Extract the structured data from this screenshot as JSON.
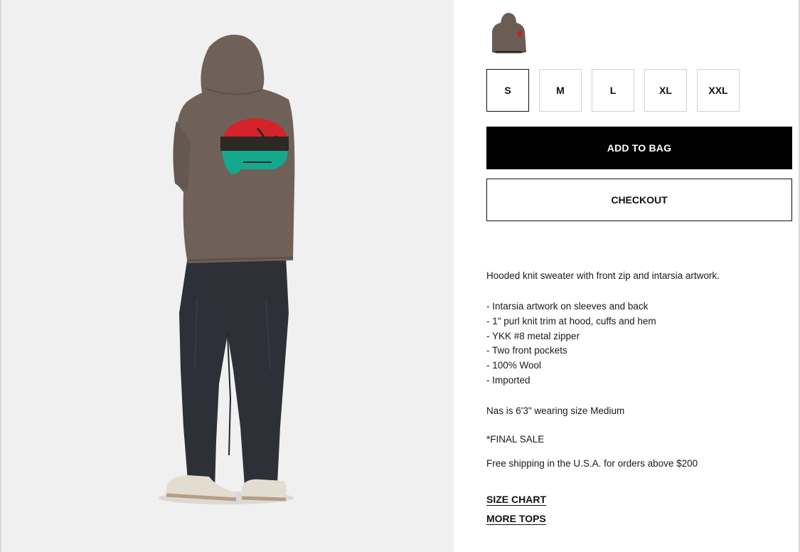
{
  "product": {
    "image_alt": "model wearing brown hooded knit sweater with intarsia artwork on back",
    "thumbnail_alt": "hooded knit sweater thumbnail"
  },
  "sizes": [
    {
      "label": "S",
      "selected": true
    },
    {
      "label": "M",
      "selected": false
    },
    {
      "label": "L",
      "selected": false
    },
    {
      "label": "XL",
      "selected": false
    },
    {
      "label": "XXL",
      "selected": false
    }
  ],
  "actions": {
    "add_to_bag": "ADD TO BAG",
    "checkout": "CHECKOUT"
  },
  "description": {
    "intro": "Hooded knit sweater with front zip and intarsia artwork.",
    "features": [
      "- Intarsia artwork on sleeves and back",
      "- 1\" purl knit trim at hood, cuffs and hem",
      "- YKK #8 metal zipper",
      "- Two front pockets",
      "- 100% Wool",
      "- Imported"
    ],
    "fit_note": "Nas is 6'3\" wearing size Medium",
    "final_sale": "*FINAL SALE",
    "shipping": "Free shipping in the U.S.A. for orders above $200"
  },
  "links": {
    "size_chart": "SIZE CHART",
    "more_tops": "MORE TOPS"
  },
  "colors": {
    "sweater": "#6f6158",
    "pants": "#2e3038",
    "art_red": "#d4232b",
    "art_teal": "#14a88f",
    "background": "#f0f0f0"
  }
}
